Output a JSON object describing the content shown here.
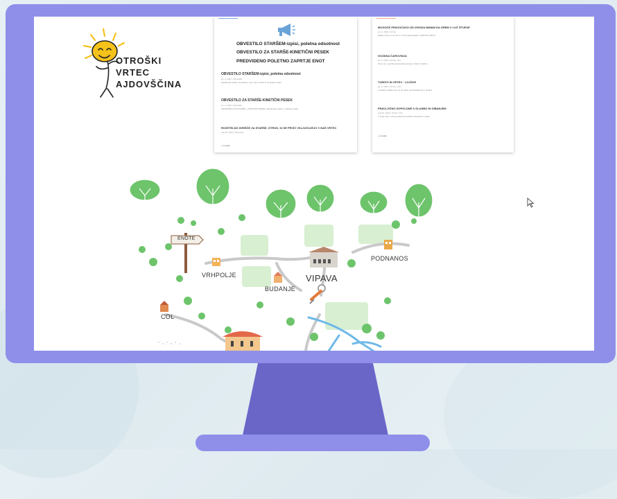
{
  "logo": {
    "line1": "OTROŠKI",
    "line2": "VRTEC",
    "line3": "AJDOVŠČINA"
  },
  "left_card": {
    "headlines": [
      "OBVESTILO STARŠEM-izpisi, poletna odsotnost",
      "OBVESTILO ZA STARŠE-KINETIČNI PESEK",
      "PREDVIDENO POLETNO ZAPRTJE ENOT"
    ],
    "items": [
      {
        "title": "OBVESTILO STARŠEM-izpisi, poletna odsotnost",
        "meta": "jun 2, 2022 | Obvestila",
        "text": "Spoštovani starši, obveščamo vas, da so obrazci na spletni strani."
      },
      {
        "title": "OBVESTILO ZA STARŠE-KINETIČNI PESEK",
        "meta": "jun 2, 2022 | Obvestila",
        "text": "OPOZORILO ZA STARŠE – KINETIČNI PESEK. Spoštovani starši, v zadnjem času."
      },
      {
        "title": "ROZETELNO IGRIŠČE ZA STARŠE, OTROK, KI SE PRVIČ VKLJUČUJEJO V NAŠ VRTEC",
        "meta": "maj 26, 2022 | Obvestila",
        "text": ""
      }
    ],
    "more": "» novejše"
  },
  "right_card": {
    "items": [
      {
        "title": "MOGOČE PRAVOČASO OD IZHODA NIMAM DA GREM V LUČ ŠTURJE",
        "meta": "jun 3, 2022 | Utrinki",
        "text": "Najprej smo se na vrtcu z otroki pogovarjali o različnih poklicih."
      },
      {
        "title": "GOZDNA ČAROVNIJA",
        "meta": "jun 2, 2022 | Utrinki, Vrtci",
        "text": "Otroci so v gozdu spoznavali drevesa, živali in rastline."
      },
      {
        "title": "TURISTI IN VRTEC · LOJČKE",
        "meta": "jun 2, 2022 | Utrinki, Vrtci",
        "text": "V skupini Lojčke smo se na izletu spoznavali kraj in okolico."
      },
      {
        "title": "PRAVLJIČNO DOPOLDNE S GLASBO IN GIBANJEM",
        "meta": "maj 30, 2022 | Utrinki, Vrtci",
        "text": "V torek smo v vrtcu pripravili pravljično dopoldne s starši."
      }
    ],
    "more": "» novejše"
  },
  "map": {
    "labels": {
      "enote": "ENOTE",
      "vrhpolje": "VRHPOLJE",
      "budanje": "BUDANJE",
      "vipava": "VIPAVA",
      "podnanos": "PODNANOS",
      "col": "COL"
    }
  },
  "colors": {
    "monitor": "#8f8fea",
    "stand_dark": "#6a66c8",
    "tree_green": "#6dc46b",
    "meadow": "#d8efd2",
    "road": "#c9c9c9",
    "river": "#6fb9e8"
  }
}
